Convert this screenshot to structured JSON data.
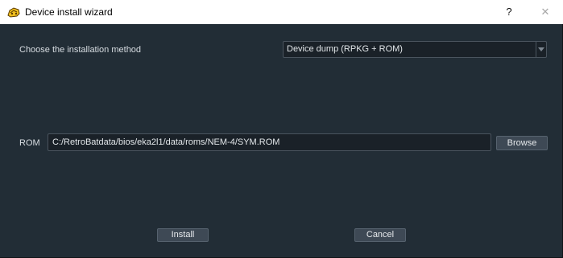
{
  "window": {
    "title": "Device install wizard",
    "help_label": "?",
    "close_label": "✕"
  },
  "method": {
    "label": "Choose the installation method",
    "selected": "Device dump (RPKG + ROM)"
  },
  "rom": {
    "label": "ROM",
    "path": "C:/RetroBatdata/bios/eka2l1/data/roms/NEM-4/SYM.ROM",
    "browse_label": "Browse"
  },
  "actions": {
    "install_label": "Install",
    "cancel_label": "Cancel"
  },
  "colors": {
    "background": "#222d36",
    "titlebar": "#ffffff",
    "button": "#3e4955",
    "field": "#1a2128",
    "icon_yellow": "#f0c020"
  }
}
